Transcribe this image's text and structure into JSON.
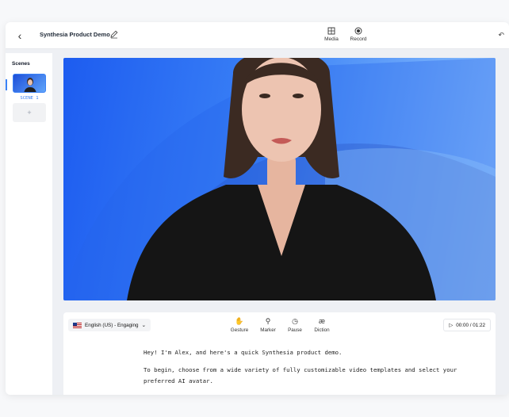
{
  "topbar": {
    "project_title": "Synthesia Product Demo",
    "media_label": "Media",
    "record_label": "Record"
  },
  "scenes": {
    "title": "Scenes",
    "items": [
      {
        "label": "SCENE 1"
      }
    ],
    "add_label": "+"
  },
  "editor": {
    "language": "English (US) - Engaging",
    "tools": [
      {
        "label": "Gesture",
        "icon": "hand-icon"
      },
      {
        "label": "Marker",
        "icon": "marker-icon"
      },
      {
        "label": "Pause",
        "icon": "clock-icon"
      },
      {
        "label": "Diction",
        "icon": "ae-icon",
        "glyph": "æ"
      }
    ],
    "timer": "00:00 / 01:22",
    "script": [
      "Hey! I'm Alex, and here's a quick Synthesia product demo.",
      "To begin, choose from a wide variety of fully customizable video templates and select your preferred AI avatar."
    ]
  },
  "colors": {
    "accent": "#3b82f6",
    "canvas_gradient_start": "#1d5cf0",
    "canvas_gradient_end": "#93c5fd"
  }
}
